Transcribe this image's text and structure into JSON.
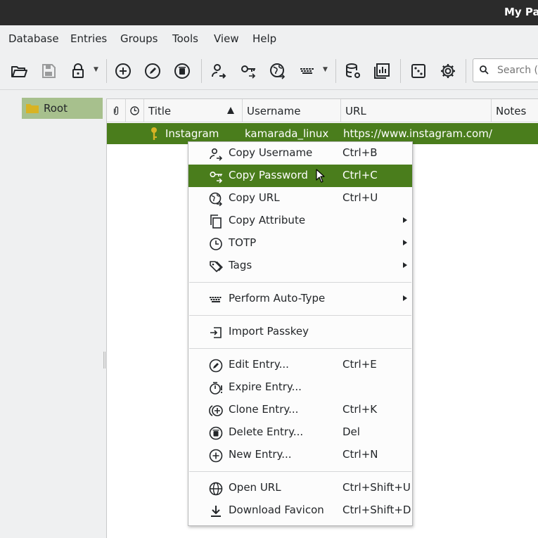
{
  "window": {
    "title": "My Pas"
  },
  "menubar": [
    "Database",
    "Entries",
    "Groups",
    "Tools",
    "View",
    "Help"
  ],
  "toolbar": {
    "buttons": [
      "open-database",
      "save-database",
      "lock-database",
      "add-entry",
      "edit-entry",
      "delete-entry",
      "copy-username",
      "copy-password",
      "copy-url",
      "auto-type",
      "database-settings",
      "database-reports",
      "password-generator",
      "settings"
    ],
    "search_placeholder": "Search ("
  },
  "groups": {
    "root_label": "Root"
  },
  "table": {
    "columns": [
      "Title",
      "Username",
      "URL",
      "Notes"
    ],
    "rows": [
      {
        "title": "Instagram",
        "username": "kamarada_linux",
        "url": "https://www.instagram.com/"
      }
    ]
  },
  "context_menu": {
    "items": [
      {
        "label": "Copy Username",
        "shortcut": "Ctrl+B",
        "icon": "copy-username-icon"
      },
      {
        "label": "Copy Password",
        "shortcut": "Ctrl+C",
        "icon": "key-icon",
        "highlighted": true
      },
      {
        "label": "Copy URL",
        "shortcut": "Ctrl+U",
        "icon": "globe-icon"
      },
      {
        "label": "Copy Attribute",
        "shortcut": "",
        "icon": "copy-icon",
        "submenu": true
      },
      {
        "label": "TOTP",
        "shortcut": "",
        "icon": "clock-icon",
        "submenu": true
      },
      {
        "label": "Tags",
        "shortcut": "",
        "icon": "tag-icon",
        "submenu": true
      },
      {
        "label": "Perform Auto-Type",
        "shortcut": "",
        "icon": "keyboard-icon",
        "submenu": true
      },
      {
        "label": "Import Passkey",
        "shortcut": "",
        "icon": "import-icon"
      },
      {
        "label": "Edit Entry...",
        "shortcut": "Ctrl+E",
        "icon": "edit-icon"
      },
      {
        "label": "Expire Entry...",
        "shortcut": "",
        "icon": "timer-icon"
      },
      {
        "label": "Clone Entry...",
        "shortcut": "Ctrl+K",
        "icon": "clone-icon"
      },
      {
        "label": "Delete Entry...",
        "shortcut": "Del",
        "icon": "delete-icon"
      },
      {
        "label": "New Entry...",
        "shortcut": "Ctrl+N",
        "icon": "add-icon"
      },
      {
        "label": "Open URL",
        "shortcut": "Ctrl+Shift+U",
        "icon": "globe-icon"
      },
      {
        "label": "Download Favicon",
        "shortcut": "Ctrl+Shift+D",
        "icon": "download-icon"
      }
    ]
  },
  "colors": {
    "selection": "#4a7d1c",
    "group_selection": "#a7c08d",
    "titlebar": "#2b2b2b"
  }
}
